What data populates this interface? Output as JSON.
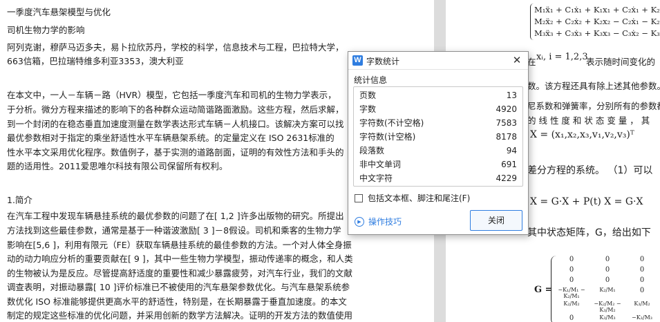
{
  "document": {
    "left_page_lines": [
      "一季度汽车悬架模型与优化",
      "司机生物力学的影响",
      "阿列克谢，穆萨马迈多夫，易卜拉欣苏丹，学校的科学，信息技术与工程，巴拉特大学，",
      "663信箱，巴拉瑞特维多利亚3353，澳大利亚",
      "在本文中，一人－车辆－路（HVR）模型，它包括一季度汽车和司机的生物力学表示，",
      "于分析。微分方程来描述的影响下的各种群众运动简谐路面激励。这些方程，然后求解，",
      "到一个封闭的在稳态垂直加速度测量在数学表达形式车辆－人机接口。该解决方案可以找",
      "最优参数相对于指定的乘坐舒适性水平车辆悬架系统。的定量定义在 ISO 2631标准的",
      "性水平本文采用优化程序。数值例子，基于实测的道路剖面，证明的有效性方法和手头的",
      "题的适用性。2011爱思唯尔科技有限公司保留所有权利。",
      "1.简介",
      "在汽车工程中发现车辆悬挂系统的最优参数的问题了在[ 1,2 ]许多出版物的研究。所提出",
      "方法找到这些最佳参数，通常是基于一种谐波激励[ 3 ]－8假设。司机和乘客的生物力学",
      "影响在[5,6 ]，利用有限元（FE）获取车辆悬挂系统的最佳参数的方法。一个对人体全身振",
      "动的动力响应分析的重要贡献在[ 9 ]，其中一些生物力学模型，振动传递率的概念，和人类",
      "的生物被认为是反应。尽管提高舒适度的重要性和减少暴露疲劳，对汽车行业，我们的文献",
      "调查表明，对振动暴露[ 10 ]评价标准已不被使用的汽车悬架参数优化。与汽车悬架系统参",
      "数优化 ISO 标准能够提供更高水平的舒适性，特别是，在长期暴露于垂直加速度。的本文",
      "制定的规定这些标准的优化问题，并采用创新的数学方法解决。证明的开发方法的数值使用"
    ],
    "right_page": {
      "eq1": "M₁ẍ₁ + C₁ẋ₁ + K₁x₁ + C₂ẋ₁ + K₂x₁ − C",
      "eq2": "M₂ẍ₂ + C₂ẋ₂ + K₂x₂ − C₂ẋ₁ − K₂x₁ − C",
      "eq3": "M₃ẍ₃ + C₃ẋ₃ + K₃x₃ − C₃ẋ₂ − K₃x₂ = C",
      "where_prefix": "在",
      "where_math": "xᵢ,  i = 1,2,3",
      "where_suffix": "表示随时间变化的",
      "line2": "数。该方程还具有除上述其他参数。",
      "line3": "尼系数和弹簧率，分别所有的参数都",
      "line4": "的 线 性 度 和 状 态 变 量 ，  其",
      "state_vec": "X = (x₁,x₂,x₃,v₁,v₂,v₃)ᵀ",
      "line5": "差分方程的系统。  （1）可以",
      "eq_system": "X = G·X + P(t)      X = G·X",
      "line6": "其中状态矩阵，G，给出如下",
      "g_label": "G =",
      "g_col1": [
        "0",
        "0",
        "0",
        "−K₁/M₁ − K₂/M₁",
        "K₂/M₂",
        "0"
      ],
      "g_col2": [
        "0",
        "0",
        "0",
        "K₂/M₁",
        "−K₂/M₂ − K₃/M₂",
        "K₃/M₃"
      ],
      "g_col3": [
        "0",
        "0",
        "0",
        "0",
        "K₃/M₂",
        "−K₃/M₃"
      ]
    }
  },
  "dialog": {
    "title": "字数统计",
    "app_icon_letter": "W",
    "close_glyph": "✕",
    "section_label": "统计信息",
    "stats": [
      {
        "label": "页数",
        "value": "13"
      },
      {
        "label": "字数",
        "value": "4920"
      },
      {
        "label": "字符数(不计空格)",
        "value": "7583"
      },
      {
        "label": "字符数(计空格)",
        "value": "8178"
      },
      {
        "label": "段落数",
        "value": "94"
      },
      {
        "label": "非中文单词",
        "value": "691"
      },
      {
        "label": "中文字符",
        "value": "4229"
      }
    ],
    "checkbox_label": "包括文本框、脚注和尾注(F)",
    "checkbox_checked": false,
    "tips_label": "操作技巧",
    "tips_icon": "play-circle-icon",
    "close_button_label": "关闭",
    "accent_color": "#2f7de0"
  }
}
